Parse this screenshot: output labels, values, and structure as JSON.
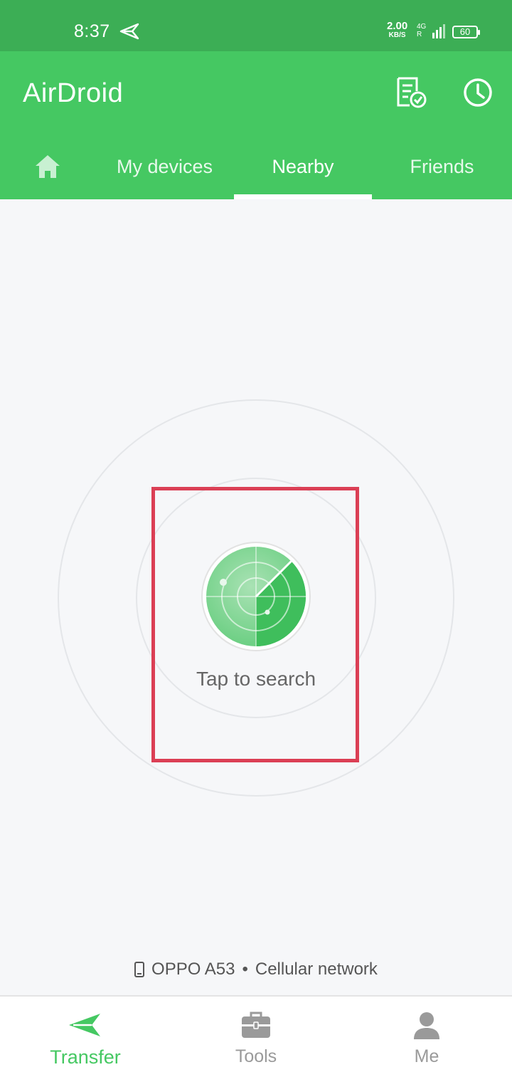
{
  "status_bar": {
    "time": "8:37",
    "speed_value": "2.00",
    "speed_unit": "KB/S",
    "network_type": "4G",
    "roaming": "R",
    "battery": "60"
  },
  "app_bar": {
    "title": "AirDroid",
    "icons": [
      "document-check-icon",
      "clock-icon"
    ]
  },
  "tabs": [
    {
      "icon": "home-icon",
      "label": ""
    },
    {
      "label": "My devices"
    },
    {
      "label": "Nearby",
      "active": true
    },
    {
      "label": "Friends"
    }
  ],
  "main": {
    "tap_label": "Tap to search",
    "device_name": "OPPO A53",
    "separator": "•",
    "network": "Cellular network"
  },
  "bottom_nav": [
    {
      "label": "Transfer",
      "icon": "paper-plane-icon",
      "active": true
    },
    {
      "label": "Tools",
      "icon": "toolbox-icon"
    },
    {
      "label": "Me",
      "icon": "person-icon"
    }
  ],
  "colors": {
    "status_bar": "#3cae55",
    "app_bar": "#45c862",
    "accent": "#45c862",
    "highlight_box": "#db3f55",
    "background": "#f6f7f9"
  }
}
